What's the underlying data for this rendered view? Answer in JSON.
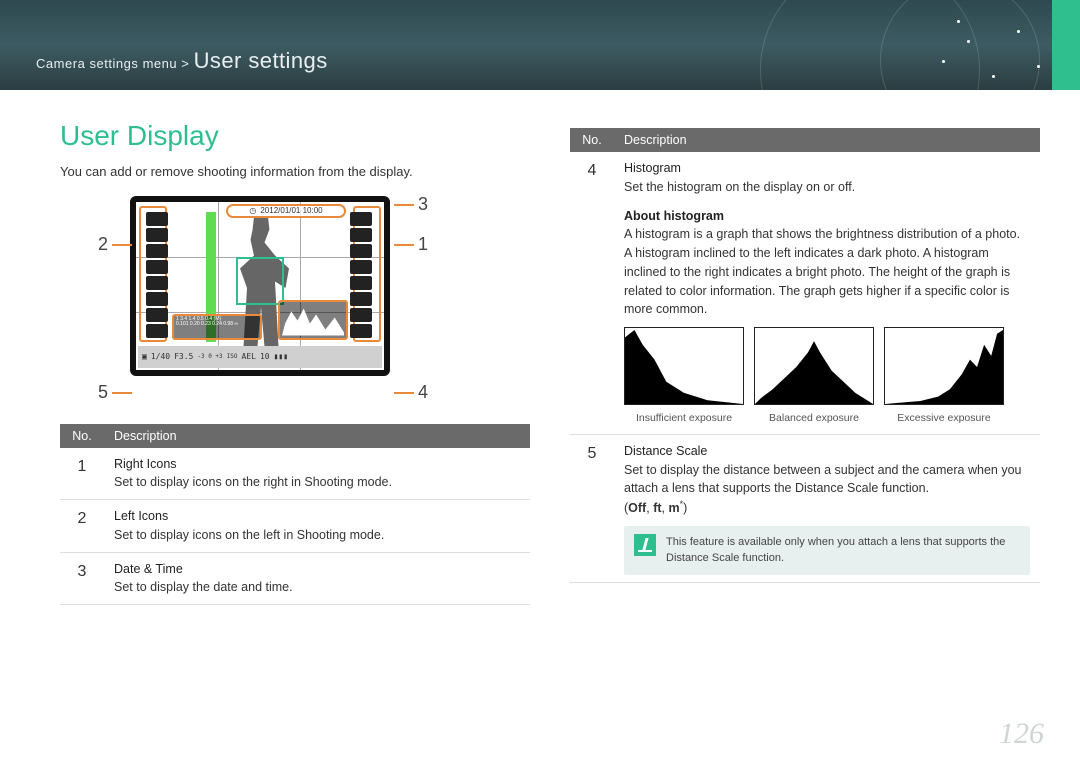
{
  "header": {
    "breadcrumb_prefix": "Camera settings menu > ",
    "breadcrumb_title": "User settings"
  },
  "section_title": "User Display",
  "intro": "You can add or remove shooting information from the display.",
  "lcd": {
    "datetime": "2012/01/01 10:00",
    "shutter": "1/40",
    "aperture": "F3.5",
    "scale_top": "1   3.4   1.4   0.5   0.4   (M)",
    "scale_bot": "0.101 0.20 0.23 0.24 0.98 ∞",
    "ev_scale": "-3   0   +3",
    "iso_label": "ISO",
    "ael": "AEL",
    "shots": "10"
  },
  "callouts": {
    "c1": "1",
    "c2": "2",
    "c3": "3",
    "c4": "4",
    "c5": "5"
  },
  "table_head": {
    "no": "No.",
    "desc": "Description"
  },
  "left_rows": [
    {
      "no": "1",
      "title": "Right Icons",
      "desc": "Set to display icons on the right in Shooting mode."
    },
    {
      "no": "2",
      "title": "Left Icons",
      "desc": "Set to display icons on the left in Shooting mode."
    },
    {
      "no": "3",
      "title": "Date & Time",
      "desc": "Set to display the date and time."
    }
  ],
  "right_rows": {
    "r4": {
      "no": "4",
      "title": "Histogram",
      "line1": "Set the histogram on the display on or off.",
      "subhead": "About histogram",
      "body": "A histogram is a graph that shows the brightness distribution of a photo. A histogram inclined to the left indicates a dark photo. A histogram inclined to the right indicates a bright photo. The height of the graph is related to color information. The graph gets higher if a specific color is more common.",
      "cap1": "Insufficient exposure",
      "cap2": "Balanced exposure",
      "cap3": "Excessive exposure"
    },
    "r5": {
      "no": "5",
      "title": "Distance Scale",
      "body": "Set to display the distance between a subject and the camera when you attach a lens that supports the Distance Scale function.",
      "opts_prefix": "(",
      "opt_off": "Off",
      "opt_ft": "ft",
      "opt_m": "m",
      "opts_suffix": ")",
      "note": "This feature is available only when you attach a lens that supports the Distance Scale function."
    }
  },
  "page_number": "126"
}
